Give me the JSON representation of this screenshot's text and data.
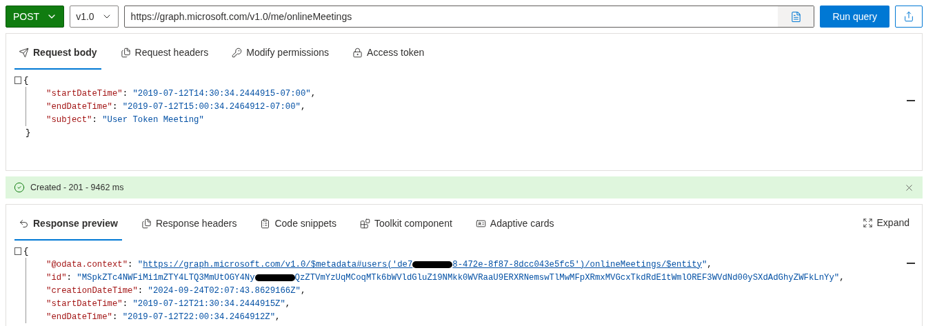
{
  "toolbar": {
    "method": "POST",
    "version": "v1.0",
    "url": "https://graph.microsoft.com/v1.0/me/onlineMeetings",
    "run_button": "Run query"
  },
  "request": {
    "tabs": [
      {
        "label": "Request body",
        "selected": true
      },
      {
        "label": "Request headers",
        "selected": false
      },
      {
        "label": "Modify permissions",
        "selected": false
      },
      {
        "label": "Access token",
        "selected": false
      }
    ],
    "code": [
      {
        "kind": "open",
        "tokens": [
          {
            "kind": "punct",
            "text": "{"
          }
        ]
      },
      {
        "kind": "member",
        "tokens": [
          {
            "kind": "key",
            "text": "\"startDateTime\""
          },
          {
            "kind": "punct",
            "text": ": "
          },
          {
            "kind": "string",
            "text": "\"2019-07-12T14:30:34.2444915-07:00\""
          },
          {
            "kind": "punct",
            "text": ","
          }
        ]
      },
      {
        "kind": "member",
        "tokens": [
          {
            "kind": "key",
            "text": "\"endDateTime\""
          },
          {
            "kind": "punct",
            "text": ": "
          },
          {
            "kind": "string",
            "text": "\"2019-07-12T15:00:34.2464912-07:00\""
          },
          {
            "kind": "punct",
            "text": ","
          }
        ]
      },
      {
        "kind": "member",
        "tokens": [
          {
            "kind": "key",
            "text": "\"subject\""
          },
          {
            "kind": "punct",
            "text": ": "
          },
          {
            "kind": "string",
            "text": "\"User Token Meeting\""
          }
        ]
      },
      {
        "kind": "close",
        "tokens": [
          {
            "kind": "punct",
            "text": "}"
          }
        ]
      }
    ]
  },
  "status": {
    "kind": "success",
    "text": "Created - 201 - 9462 ms"
  },
  "response": {
    "tabs": [
      {
        "label": "Response preview",
        "selected": true
      },
      {
        "label": "Response headers",
        "selected": false
      },
      {
        "label": "Code snippets",
        "selected": false
      },
      {
        "label": "Toolkit component",
        "selected": false
      },
      {
        "label": "Adaptive cards",
        "selected": false
      }
    ],
    "expand": "Expand",
    "code": [
      {
        "kind": "open",
        "tokens": [
          {
            "kind": "punct",
            "text": "{"
          }
        ]
      },
      {
        "kind": "member",
        "tokens": [
          {
            "kind": "key",
            "text": "\"@odata.context\""
          },
          {
            "kind": "punct",
            "text": ": "
          },
          {
            "kind": "string",
            "text": "\""
          },
          {
            "kind": "link",
            "text": "https://graph.microsoft.com/v1.0/$metadata#users('de7"
          },
          {
            "kind": "redacted"
          },
          {
            "kind": "link",
            "text": "8-472e-8f87-8dcc043e5fc5')/onlineMeetings/$entity"
          },
          {
            "kind": "string",
            "text": "\""
          },
          {
            "kind": "punct",
            "text": ","
          }
        ]
      },
      {
        "kind": "member",
        "tokens": [
          {
            "kind": "key",
            "text": "\"id\""
          },
          {
            "kind": "punct",
            "text": ": "
          },
          {
            "kind": "string",
            "text": "\"MSpkZTc4NWFiMi1mZTY4LTQ3MmUtOGY4Ny"
          },
          {
            "kind": "redacted"
          },
          {
            "kind": "string",
            "text": "QzZTVmYzUqMCoqMTk6bWVldGluZ19NMkk0WVRaaU9ERXRNemswTlMwMFpXRmxMVGcxTkdRdE1tWmlOREF3WVdNd00ySXdAdGhyZWFkLnYy\""
          },
          {
            "kind": "punct",
            "text": ","
          }
        ]
      },
      {
        "kind": "member",
        "tokens": [
          {
            "kind": "key",
            "text": "\"creationDateTime\""
          },
          {
            "kind": "punct",
            "text": ": "
          },
          {
            "kind": "string",
            "text": "\"2024-09-24T02:07:43.8629166Z\""
          },
          {
            "kind": "punct",
            "text": ","
          }
        ]
      },
      {
        "kind": "member",
        "tokens": [
          {
            "kind": "key",
            "text": "\"startDateTime\""
          },
          {
            "kind": "punct",
            "text": ": "
          },
          {
            "kind": "string",
            "text": "\"2019-07-12T21:30:34.2444915Z\""
          },
          {
            "kind": "punct",
            "text": ","
          }
        ]
      },
      {
        "kind": "member",
        "tokens": [
          {
            "kind": "key",
            "text": "\"endDateTime\""
          },
          {
            "kind": "punct",
            "text": ": "
          },
          {
            "kind": "string",
            "text": "\"2019-07-12T22:00:34.2464912Z\""
          },
          {
            "kind": "punct",
            "text": ","
          }
        ]
      }
    ]
  }
}
